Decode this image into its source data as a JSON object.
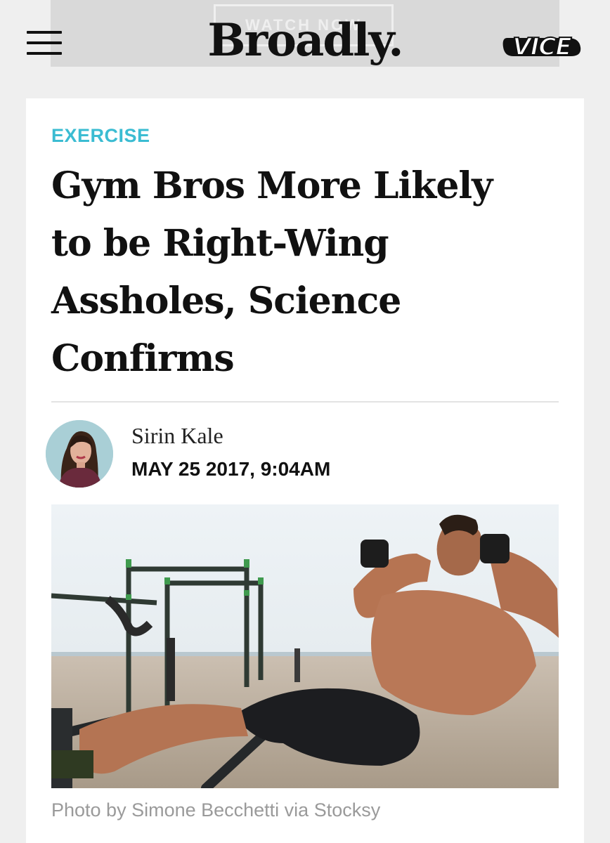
{
  "promo": {
    "button_label": "WATCH NOW"
  },
  "header": {
    "brand": "Broadly.",
    "network_logo": "VICE",
    "menu_icon": "hamburger-menu-icon"
  },
  "article": {
    "section": "EXERCISE",
    "headline_lines": [
      "Gym Bros More Likely",
      "to be Right-Wing",
      "Assholes, Science",
      "Confirms"
    ],
    "author": "Sirin Kale",
    "date": "MAY 25 2017, 9:04AM",
    "caption": "Photo by Simone Becchetti via Stocksy"
  },
  "colors": {
    "section_accent": "#3bbcd2",
    "page_bg": "#efefef",
    "card_bg": "#ffffff"
  }
}
